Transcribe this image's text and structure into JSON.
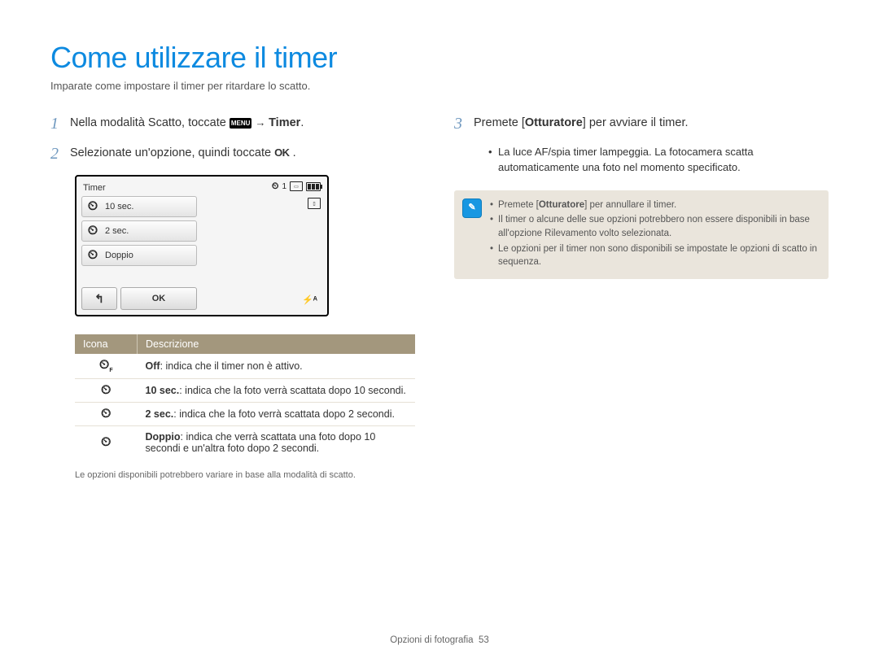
{
  "title": "Come utilizzare il timer",
  "subtitle": "Imparate come impostare il timer per ritardare lo scatto.",
  "steps": {
    "s1_num": "1",
    "s1_pre": "Nella modalità Scatto, toccate ",
    "s1_menu": "MENU",
    "s1_arrow": " → ",
    "s1_bold": "Timer",
    "s1_post": ".",
    "s2_num": "2",
    "s2_pre": "Selezionate un'opzione, quindi toccate ",
    "s2_ok": "OK",
    "s2_post": ".",
    "s3_num": "3",
    "s3_pre": "Premete [",
    "s3_bold": "Otturatore",
    "s3_post": "] per avviare il timer."
  },
  "camera": {
    "title": "Timer",
    "items": [
      {
        "icon": "10",
        "label": "10 sec."
      },
      {
        "icon": "2",
        "label": "2 sec."
      },
      {
        "icon": "dbl",
        "label": "Doppio"
      }
    ],
    "back": "↰",
    "ok": "OK",
    "top_count": "1",
    "flash": "⚡ᴬ"
  },
  "table": {
    "head_icon": "Icona",
    "head_desc": "Descrizione",
    "rows": [
      {
        "icon_label": "OFF",
        "bold": "Off",
        "rest": ": indica che il timer non è attivo."
      },
      {
        "icon_label": "10",
        "bold": "10 sec.",
        "rest": ": indica che la foto verrà scattata dopo 10 secondi."
      },
      {
        "icon_label": "2",
        "bold": "2 sec.",
        "rest": ": indica che la foto verrà scattata dopo 2 secondi."
      },
      {
        "icon_label": "dbl",
        "bold": "Doppio",
        "rest": ": indica che verrà scattata una foto dopo 10 secondi e un'altra foto dopo 2 secondi."
      }
    ],
    "note": "Le opzioni disponibili potrebbero variare in base alla modalità di scatto."
  },
  "right_bullet": "La luce AF/spia timer lampeggia. La fotocamera scatta automaticamente una foto nel momento specificato.",
  "note_box": {
    "icon": "✎",
    "items": [
      {
        "pre": "Premete [",
        "bold": "Otturatore",
        "post": "] per annullare il timer."
      },
      {
        "text": "Il timer o alcune delle sue opzioni potrebbero non essere disponibili in base all'opzione Rilevamento volto selezionata."
      },
      {
        "text": "Le opzioni per il timer non sono disponibili se impostate le opzioni di scatto in sequenza."
      }
    ]
  },
  "footer_label": "Opzioni di fotografia",
  "footer_page": "53"
}
